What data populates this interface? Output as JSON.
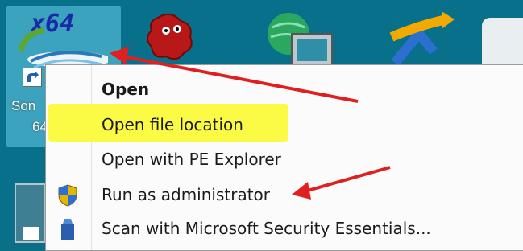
{
  "desktop": {
    "selected_icon": {
      "badge": "x64",
      "label_line1": "Son",
      "label_line2": "64"
    }
  },
  "context_menu": {
    "items": [
      {
        "label": "Open",
        "bold": true,
        "icon": ""
      },
      {
        "label": "Open file location",
        "bold": false,
        "icon": ""
      },
      {
        "label": "Open with PE Explorer",
        "bold": false,
        "icon": ""
      },
      {
        "label": "Run as administrator",
        "bold": false,
        "icon": "uac-shield-icon"
      },
      {
        "label": "Scan with Microsoft Security Essentials...",
        "bold": false,
        "icon": "security-essentials-icon"
      }
    ]
  },
  "annotations": {
    "highlight_color": "#fbfb3c",
    "arrow_color": "#e02020"
  }
}
